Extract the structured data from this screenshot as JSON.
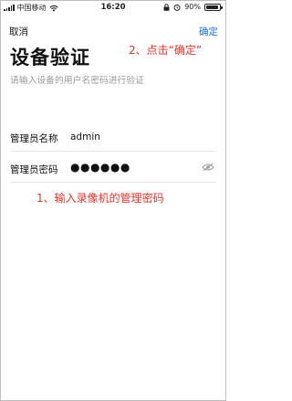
{
  "status_bar": {
    "carrier": "中国移动",
    "time": "16:20",
    "battery": "90%",
    "battery_level": 0.9
  },
  "nav": {
    "cancel_label": "取消",
    "confirm_label": "确定"
  },
  "page": {
    "title": "设备验证",
    "subtitle": "请输入设备的用户名密码进行验证"
  },
  "form": {
    "username": {
      "label": "管理员名称",
      "value": "admin"
    },
    "password": {
      "label": "管理员密码",
      "value": "●●●●●●"
    }
  },
  "annotations": {
    "step1": "1、输入录像机的管理密码",
    "step2": "2、点击“确定”"
  },
  "colors": {
    "accent": "#1a73e8",
    "annotation": "#e8342a",
    "subtitle": "#9a9a9a"
  },
  "icons": {
    "password_toggle": "eye-icon",
    "wifi": "wifi-icon",
    "lock": "lock-icon",
    "alarm": "alarm-icon"
  }
}
